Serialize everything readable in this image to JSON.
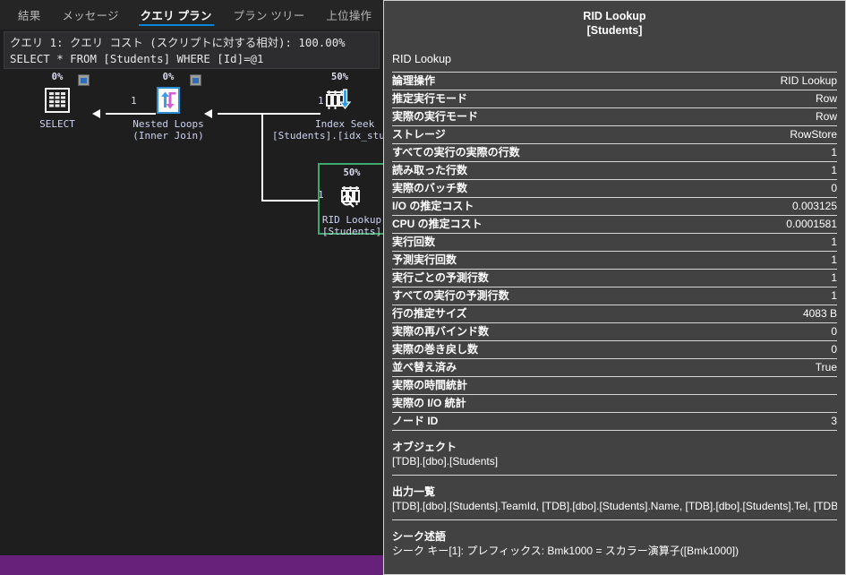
{
  "tabs": [
    {
      "label": "結果",
      "active": false
    },
    {
      "label": "メッセージ",
      "active": false
    },
    {
      "label": "クエリ プラン",
      "active": true
    },
    {
      "label": "プラン ツリー",
      "active": false
    },
    {
      "label": "上位操作",
      "active": false
    }
  ],
  "query_header": {
    "cost_line": "クエリ 1: クエリ コスト (スクリプトに対する相対): 100.00%",
    "sql_line": "SELECT * FROM [Students] WHERE [Id]=@1"
  },
  "plan": {
    "nodes": [
      {
        "id": "select",
        "cost_pct": "0%",
        "icon": "select-result-icon",
        "line1": "SELECT",
        "line2": ""
      },
      {
        "id": "nested-loops",
        "cost_pct": "0%",
        "icon": "nested-loops-icon",
        "line1": "Nested Loops",
        "line2": "(Inner Join)"
      },
      {
        "id": "index-seek",
        "cost_pct": "50%",
        "icon": "index-seek-icon",
        "line1": "Index Seek",
        "line2": "[Students].[idx_stude"
      },
      {
        "id": "rid-lookup",
        "cost_pct": "50%",
        "icon": "rid-lookup-icon",
        "line1": "RID Lookup",
        "line2": "[Students]",
        "selected": true
      }
    ],
    "row_labels": [
      "1",
      "1",
      "1"
    ],
    "selection_color": "#3fa96b"
  },
  "tooltip": {
    "title": "RID Lookup",
    "subtitle": "[Students]",
    "physical_operation": "RID Lookup",
    "rows": [
      {
        "key": "論理操作",
        "value": "RID Lookup"
      },
      {
        "key": "推定実行モード",
        "value": "Row"
      },
      {
        "key": "実際の実行モード",
        "value": "Row"
      },
      {
        "key": "ストレージ",
        "value": "RowStore"
      },
      {
        "key": "すべての実行の実際の行数",
        "value": "1"
      },
      {
        "key": "読み取った行数",
        "value": "1"
      },
      {
        "key": "実際のバッチ数",
        "value": "0"
      },
      {
        "key": "I/O の推定コスト",
        "value": "0.003125"
      },
      {
        "key": "CPU の推定コスト",
        "value": "0.0001581"
      },
      {
        "key": "実行回数",
        "value": "1"
      },
      {
        "key": "予測実行回数",
        "value": "1"
      },
      {
        "key": "実行ごとの予測行数",
        "value": "1"
      },
      {
        "key": "すべての実行の予測行数",
        "value": "1"
      },
      {
        "key": "行の推定サイズ",
        "value": "4083 B"
      },
      {
        "key": "実際の再バインド数",
        "value": "0"
      },
      {
        "key": "実際の巻き戻し数",
        "value": "0"
      },
      {
        "key": "並べ替え済み",
        "value": "True"
      },
      {
        "key": "実際の時間統計",
        "value": ""
      },
      {
        "key": "実際の I/O 統計",
        "value": ""
      },
      {
        "key": "ノード ID",
        "value": "3"
      }
    ],
    "blocks": [
      {
        "key": "オブジェクト",
        "value": "[TDB].[dbo].[Students]"
      },
      {
        "key": "出力一覧",
        "value": "[TDB].[dbo].[Students].TeamId, [TDB].[dbo].[Students].Name, [TDB].[dbo].[Students].Tel, [TDB].[dbo]...."
      },
      {
        "key": "シーク述語",
        "value": "シーク キー[1]: プレフィックス: Bmk1000 = スカラー演算子([Bmk1000])"
      }
    ]
  },
  "colors": {
    "accent_tab_underline": "#0a84d8",
    "status_bar": "#68217a",
    "panel_bg": "#424242",
    "canvas_bg": "#1e1e1e"
  }
}
